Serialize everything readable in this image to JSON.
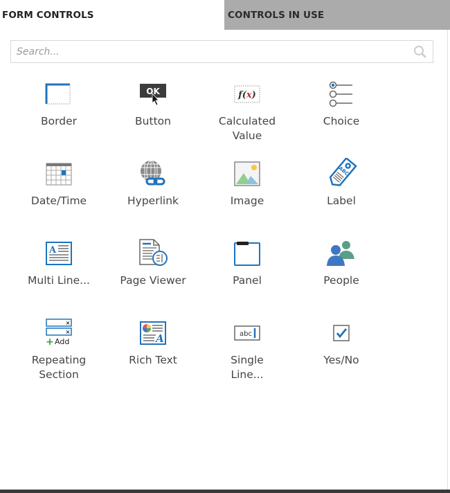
{
  "tabs": [
    {
      "label": "FORM CONTROLS",
      "active": true
    },
    {
      "label": "CONTROLS IN USE",
      "active": false
    }
  ],
  "search": {
    "placeholder": "Search...",
    "value": "",
    "icon": "search-icon"
  },
  "controls": [
    {
      "label": "Border",
      "icon": "border-icon"
    },
    {
      "label": "Button",
      "icon": "button-ok-icon"
    },
    {
      "label": "Calculated Value",
      "icon": "formula-icon"
    },
    {
      "label": "Choice",
      "icon": "radio-list-icon"
    },
    {
      "label": "Date/Time",
      "icon": "calendar-icon"
    },
    {
      "label": "Hyperlink",
      "icon": "globe-link-icon"
    },
    {
      "label": "Image",
      "icon": "image-icon"
    },
    {
      "label": "Label",
      "icon": "tag-icon"
    },
    {
      "label": "Multi Line...",
      "icon": "multiline-text-icon"
    },
    {
      "label": "Page Viewer",
      "icon": "page-viewer-icon"
    },
    {
      "label": "Panel",
      "icon": "panel-icon"
    },
    {
      "label": "People",
      "icon": "people-icon"
    },
    {
      "label": "Repeating Section",
      "icon": "repeating-section-icon"
    },
    {
      "label": "Rich Text",
      "icon": "rich-text-icon"
    },
    {
      "label": "Single Line...",
      "icon": "single-line-text-icon"
    },
    {
      "label": "Yes/No",
      "icon": "checkbox-icon"
    }
  ],
  "icon_text": {
    "button": "OK",
    "formula": "f(x)",
    "single_line": "abc",
    "label_tag": "ABC",
    "add": "Add"
  },
  "colors": {
    "accent_blue": "#1e73be",
    "inactive_tab": "#ababab",
    "text": "#454545"
  }
}
